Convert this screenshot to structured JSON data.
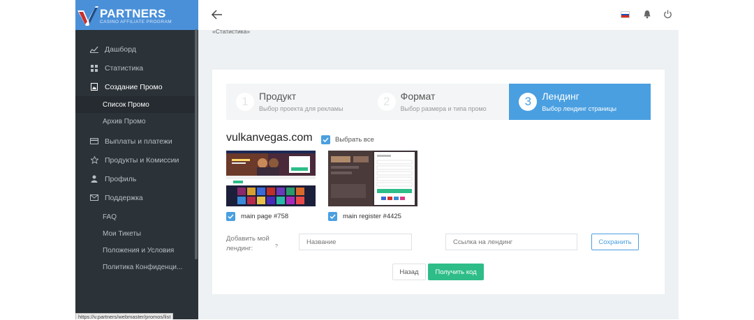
{
  "brand": {
    "name": "PARTNERS",
    "tagline": "CASINO AFFILIATE PROGRAM",
    "color": "#4a90d9"
  },
  "sidebar": {
    "items": [
      {
        "label": "Дашборд",
        "icon": "chart-line-icon"
      },
      {
        "label": "Статистика",
        "icon": "grid-icon"
      },
      {
        "label": "Создание Промо",
        "icon": "image-icon",
        "active": true
      },
      {
        "label": "Список Промо",
        "sub": true,
        "active": true
      },
      {
        "label": "Архив Промо",
        "sub": true
      },
      {
        "label": "Выплаты и платежи",
        "icon": "credit-card-icon"
      },
      {
        "label": "Продукты и Комиссии",
        "icon": "star-icon"
      },
      {
        "label": "Профиль",
        "icon": "user-icon"
      },
      {
        "label": "Поддержка",
        "icon": "envelope-icon"
      },
      {
        "label": "FAQ",
        "sub": true
      },
      {
        "label": "Мои Тикеты",
        "sub": true
      },
      {
        "label": "Положения и Условия",
        "sub": true
      },
      {
        "label": "Политика Конфиденци...",
        "sub": true
      }
    ]
  },
  "header": {
    "back_icon": "arrow-left-icon",
    "language_icon": "russia-flag-icon",
    "notifications_icon": "bell-icon",
    "logout_icon": "power-icon"
  },
  "breadcrumb": "«Статистика»",
  "steps": [
    {
      "number": "1",
      "title": "Продукт",
      "subtitle": "Выбор проекта для рекламы"
    },
    {
      "number": "2",
      "title": "Формат",
      "subtitle": "Выбор размера и типа промо"
    },
    {
      "number": "3",
      "title": "Лендинг",
      "subtitle": "Выбор лендинг страницы",
      "active": true
    }
  ],
  "landing": {
    "site": "vulkanvegas.com",
    "select_all_label": "Выбрать все",
    "pages": [
      {
        "label": "main page #758",
        "checked": true
      },
      {
        "label": "main register #4425",
        "checked": true
      }
    ],
    "add_label": "Добавить мой лендинг:",
    "help_mark": "?",
    "name_placeholder": "Название",
    "url_placeholder": "Ссылка на лендинг",
    "save_label": "Сохранить"
  },
  "actions": {
    "back_label": "Назад",
    "get_code_label": "Получить код"
  },
  "status_url": "https://v.partners/webmaster/promos/list",
  "colors": {
    "sidebar_bg": "#2b3238",
    "accent": "#4a9fe0",
    "success": "#2ebd88"
  }
}
